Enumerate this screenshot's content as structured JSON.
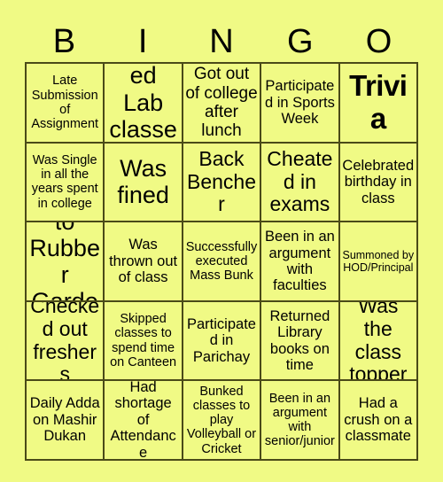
{
  "card": {
    "title_letters": [
      "B",
      "I",
      "N",
      "G",
      "O"
    ],
    "background_color": "#f0fa85",
    "border_color": "#4a4a18",
    "text_color": "#000000",
    "rows": 5,
    "columns": 5
  },
  "cells": [
    {
      "text": "Late Submission of Assignment",
      "size": "sz-s"
    },
    {
      "text": "Skipped Lab classes",
      "size": "sz-xxl"
    },
    {
      "text": "Got out of college after lunch",
      "size": "sz-l"
    },
    {
      "text": "Participated in Sports Week",
      "size": "sz-m"
    },
    {
      "text": "Trivia",
      "size": "sz-free"
    },
    {
      "text": "Was Single in all the years spent in college",
      "size": "sz-s"
    },
    {
      "text": "Was fined",
      "size": "sz-xxl"
    },
    {
      "text": "Back Bencher",
      "size": "sz-xl"
    },
    {
      "text": "Cheated in exams",
      "size": "sz-xl"
    },
    {
      "text": "Celebrated birthday in class",
      "size": "sz-m"
    },
    {
      "text": "Been to Rubber Garden",
      "size": "sz-xxl"
    },
    {
      "text": "Was thrown out of class",
      "size": "sz-m"
    },
    {
      "text": "Successfully executed Mass Bunk",
      "size": "sz-s"
    },
    {
      "text": "Been in an argument with faculties",
      "size": "sz-m"
    },
    {
      "text": "Summoned by HOD/Principal",
      "size": "sz-xs"
    },
    {
      "text": "Checked out freshers",
      "size": "sz-xl"
    },
    {
      "text": "Skipped classes to spend time on Canteen",
      "size": "sz-s"
    },
    {
      "text": "Participated in Parichay",
      "size": "sz-m"
    },
    {
      "text": "Returned Library books on time",
      "size": "sz-m"
    },
    {
      "text": "Was the class topper",
      "size": "sz-xl"
    },
    {
      "text": "Daily Adda on Mashir Dukan",
      "size": "sz-m"
    },
    {
      "text": "Had shortage of Attendance",
      "size": "sz-m"
    },
    {
      "text": "Bunked classes to play Volleyball or Cricket",
      "size": "sz-s"
    },
    {
      "text": "Been in an argument with senior/junior",
      "size": "sz-s"
    },
    {
      "text": "Had a crush on a classmate",
      "size": "sz-m"
    }
  ]
}
